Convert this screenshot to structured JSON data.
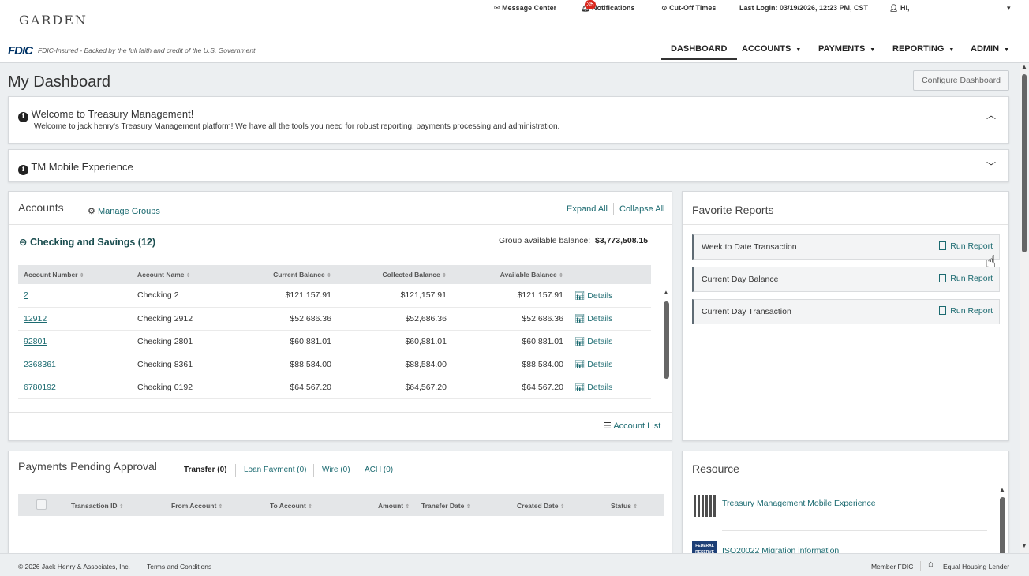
{
  "brand": {
    "logo": "GARDEN",
    "fdic_mark": "FDIC",
    "fdic_text": "FDIC-Insured - Backed by the full faith and credit of the U.S. Government"
  },
  "utility": {
    "message_center": "Message Center",
    "notifications": "Notifications",
    "notification_count": "35",
    "cutoff_times": "Cut-Off Times",
    "last_login": "Last Login: 03/19/2026, 12:23 PM, CST",
    "greeting": "Hi,"
  },
  "nav": {
    "dashboard": "DASHBOARD",
    "accounts": "ACCOUNTS",
    "payments": "PAYMENTS",
    "reporting": "REPORTING",
    "admin": "ADMIN"
  },
  "page": {
    "title": "My Dashboard",
    "configure_button": "Configure Dashboard"
  },
  "welcome": {
    "title": "Welcome to Treasury Management!",
    "body": "Welcome to jack henry's Treasury Management platform! We have all the tools you need for robust reporting, payments processing and administration."
  },
  "mobile": {
    "title": "TM Mobile Experience"
  },
  "accounts": {
    "title": "Accounts",
    "manage_groups": "Manage Groups",
    "expand_all": "Expand All",
    "collapse_all": "Collapse All",
    "group_name": "Checking and Savings (12)",
    "group_balance_label": "Group available balance:",
    "group_balance": "$3,773,508.15",
    "columns": [
      "Account Number",
      "Account Name",
      "Current Balance",
      "Collected Balance",
      "Available Balance"
    ],
    "details_label": "Details",
    "rows": [
      {
        "number": "2",
        "name": "Checking 2",
        "current": "$121,157.91",
        "collected": "$121,157.91",
        "available": "$121,157.91"
      },
      {
        "number": "12912",
        "name": "Checking 2912",
        "current": "$52,686.36",
        "collected": "$52,686.36",
        "available": "$52,686.36"
      },
      {
        "number": "92801",
        "name": "Checking 2801",
        "current": "$60,881.01",
        "collected": "$60,881.01",
        "available": "$60,881.01"
      },
      {
        "number": "2368361",
        "name": "Checking 8361",
        "current": "$88,584.00",
        "collected": "$88,584.00",
        "available": "$88,584.00"
      },
      {
        "number": "6780192",
        "name": "Checking 0192",
        "current": "$64,567.20",
        "collected": "$64,567.20",
        "available": "$64,567.20"
      }
    ],
    "account_list": "Account List"
  },
  "favorite_reports": {
    "title": "Favorite Reports",
    "run_label": "Run Report",
    "items": [
      "Week to Date Transaction",
      "Current Day Balance",
      "Current Day Transaction"
    ]
  },
  "payments": {
    "title": "Payments Pending Approval",
    "tabs": [
      "Transfer (0)",
      "Loan Payment (0)",
      "Wire (0)",
      "ACH (0)"
    ],
    "columns": [
      "Transaction ID",
      "From Account",
      "To Account",
      "Amount",
      "Transfer Date",
      "Created Date",
      "Status"
    ]
  },
  "resource": {
    "title": "Resource",
    "items": [
      "Treasury Management Mobile Experience",
      "ISO20022 Migration information"
    ],
    "fed_logo_text": "FEDERAL RESERVE"
  },
  "footer": {
    "copyright": "© 2026 Jack Henry & Associates, Inc.",
    "terms": "Terms and Conditions",
    "member_fdic": "Member FDIC",
    "equal_housing": "Equal Housing Lender"
  },
  "colors": {
    "link": "#1b6a70",
    "badge": "#d9261c",
    "fdic_blue": "#003366"
  }
}
